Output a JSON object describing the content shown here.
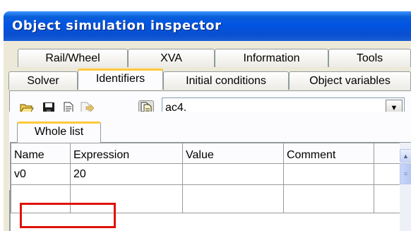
{
  "window": {
    "title": "Object simulation inspector"
  },
  "tabs_row1": [
    "Rail/Wheel",
    "XVA",
    "Information",
    "Tools"
  ],
  "tabs_row2": [
    "Solver",
    "Identifiers",
    "Initial conditions",
    "Object variables"
  ],
  "active_tab": "Identifiers",
  "toolbar": {
    "icons": [
      "open-folder-icon",
      "save-icon",
      "document-icon",
      "export-icon",
      "copy-icon"
    ],
    "combo_value": "ac4."
  },
  "subtab": {
    "label": "Whole list"
  },
  "grid": {
    "columns": [
      "Name",
      "Expression",
      "Value",
      "Comment"
    ],
    "rows": [
      {
        "name": "v0",
        "expression": "20",
        "value": "",
        "comment": ""
      }
    ]
  }
}
